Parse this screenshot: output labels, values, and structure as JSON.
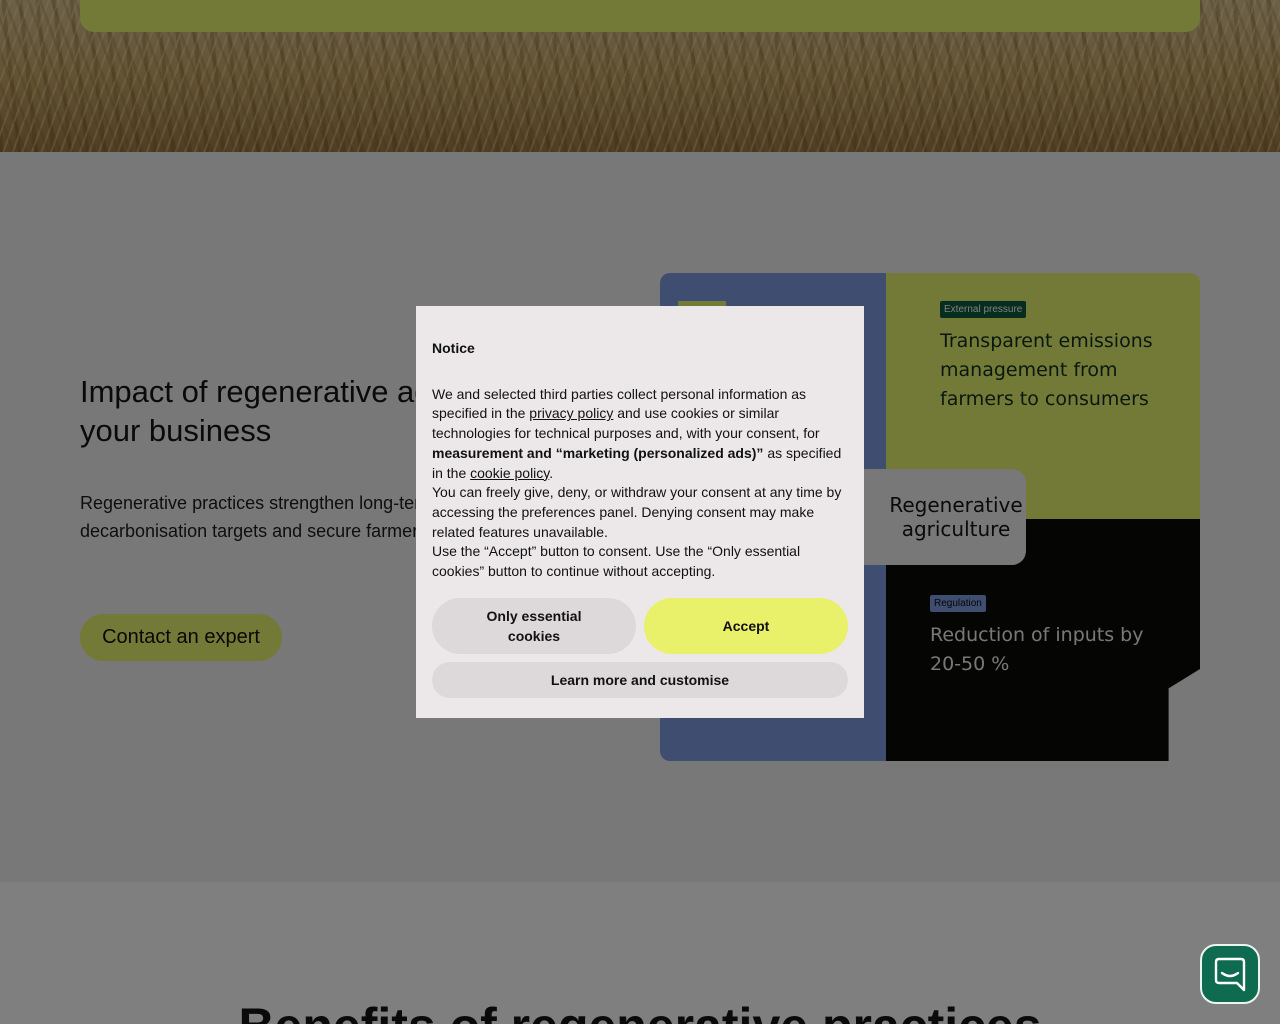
{
  "hero": {},
  "section": {
    "heading": "Impact of regenerative agriculture on your business",
    "body": "Regenerative practices strengthen long-term supply, support your decarbonisation targets and secure farmer relationships.",
    "cta_label": "Contact an expert"
  },
  "graphic": {
    "tag_external": "External pressure",
    "text_green": "Transparent emissions management from farmers to consumers",
    "center_label": "Regenerative agriculture",
    "tag_regulation": "Regulation",
    "text_black": "Reduction of inputs by 20-50 %"
  },
  "section2": {
    "title": "Benefits of regenerative practices"
  },
  "modal": {
    "title": "Notice",
    "p1_a": "We and selected third parties collect personal information as specified in the ",
    "p1_link1": "privacy policy",
    "p1_b": " and use cookies or similar technologies for technical purposes and, with your consent, for ",
    "p1_bold": "measurement and “marketing (personalized ads)”",
    "p1_c": " as specified in the ",
    "p1_link2": "cookie policy",
    "p1_d": ".",
    "p2": "You can freely give, deny, or withdraw your consent at any time by accessing the preferences panel. Denying consent may make related features unavailable.",
    "p3": "Use the “Accept” button to consent. Use the “Only essential cookies” button to continue without accepting.",
    "btn_essential": "Only essential cookies",
    "btn_accept": "Accept",
    "btn_learn": "Learn more and customise"
  },
  "chat": {
    "icon": "chat-bubble-icon"
  },
  "colors": {
    "accent_lime": "#e7f26f",
    "brand_green": "#0e6b4f",
    "blue": "#7d9ae0",
    "overlay": "rgba(0,0,0,0.5)"
  }
}
